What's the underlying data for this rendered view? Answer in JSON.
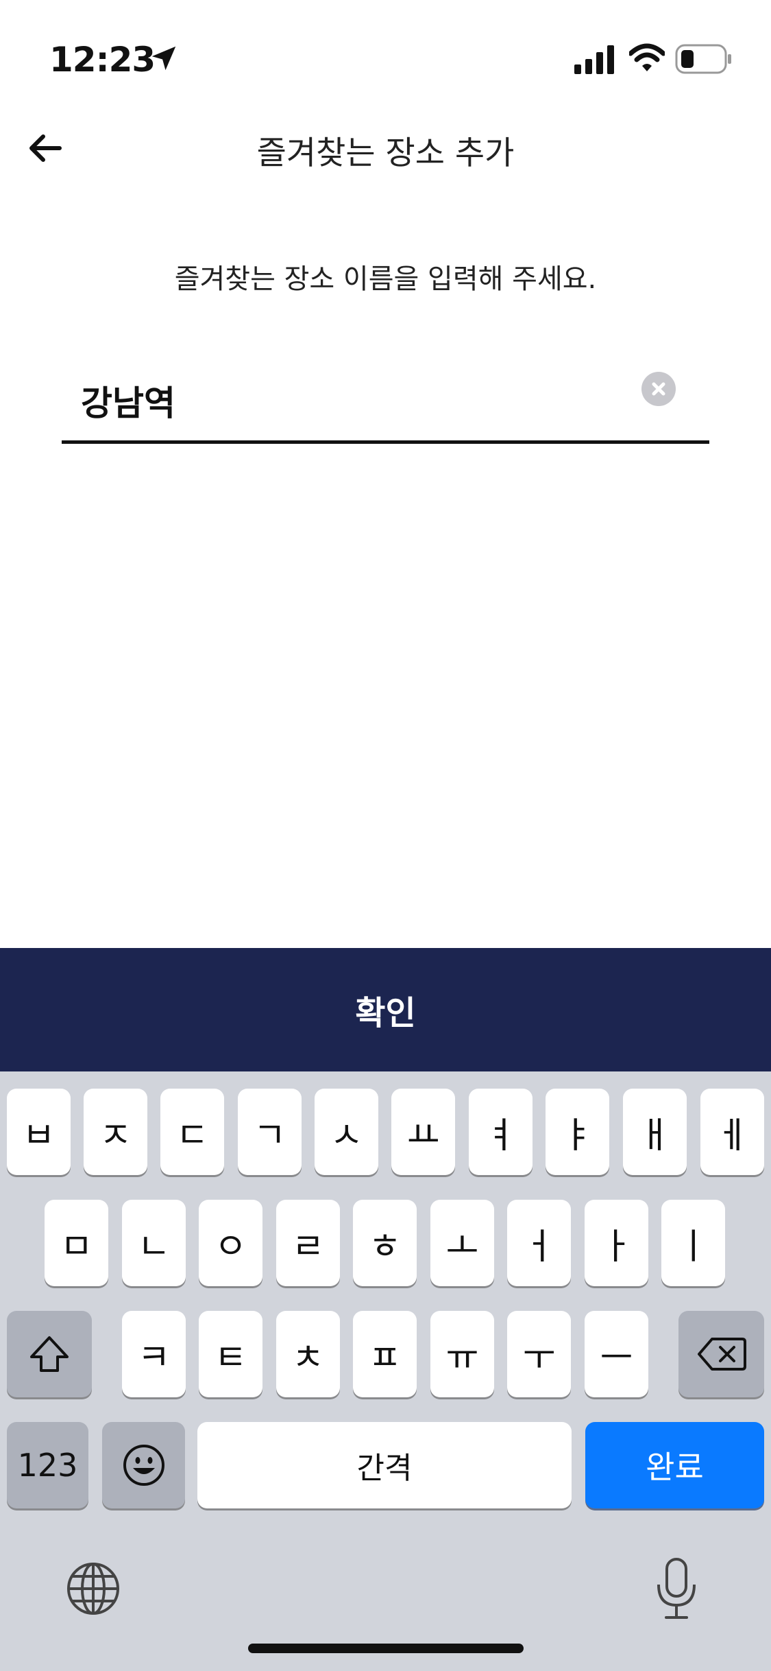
{
  "status_bar": {
    "time": "12:23",
    "icons": [
      "location-arrow-icon",
      "signal-icon",
      "wifi-icon",
      "battery-icon"
    ]
  },
  "header": {
    "title": "즐겨찾는 장소 추가",
    "back_icon": "arrow-left-icon"
  },
  "prompt": "즐겨찾는 장소 이름을 입력해 주세요.",
  "place_name_input": {
    "value": "강남역",
    "clear_icon": "clear-circle-icon"
  },
  "confirm_button": {
    "label": "확인",
    "color": "#1c2550"
  },
  "keyboard": {
    "row1": [
      "ㅂ",
      "ㅈ",
      "ㄷ",
      "ㄱ",
      "ㅅ",
      "ㅛ",
      "ㅕ",
      "ㅑ",
      "ㅐ",
      "ㅔ"
    ],
    "row2": [
      "ㅁ",
      "ㄴ",
      "ㅇ",
      "ㄹ",
      "ㅎ",
      "ㅗ",
      "ㅓ",
      "ㅏ",
      "ㅣ"
    ],
    "row3": [
      "ㅋ",
      "ㅌ",
      "ㅊ",
      "ㅍ",
      "ㅠ",
      "ㅜ",
      "ㅡ"
    ],
    "shift_icon": "shift-icon",
    "delete_icon": "backspace-icon",
    "numbers_label": "123",
    "emoji_icon": "emoji-icon",
    "space_label": "간격",
    "return_label": "완료",
    "return_color": "#0a7aff",
    "globe_icon": "globe-icon",
    "mic_icon": "microphone-icon"
  }
}
